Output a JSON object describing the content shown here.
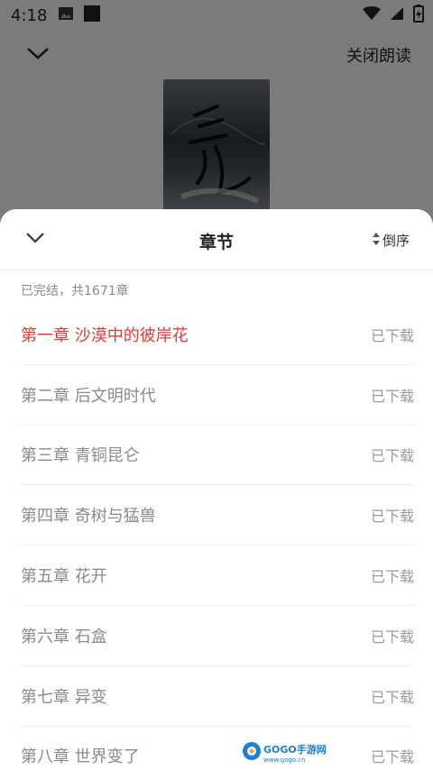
{
  "status_bar": {
    "time": "4:18"
  },
  "top_bar": {
    "close_read_label": "关闭朗读"
  },
  "sheet": {
    "title": "章节",
    "sort_label": "倒序",
    "summary": "已完结，共1671章",
    "chapters": [
      {
        "title": "第一章 沙漠中的彼岸花",
        "status": "已下载"
      },
      {
        "title": "第二章 后文明时代",
        "status": "已下载"
      },
      {
        "title": "第三章 青铜昆仑",
        "status": "已下载"
      },
      {
        "title": "第四章 奇树与猛兽",
        "status": "已下载"
      },
      {
        "title": "第五章 花开",
        "status": "已下载"
      },
      {
        "title": "第六章 石盒",
        "status": "已下载"
      },
      {
        "title": "第七章 异变",
        "status": "已下载"
      },
      {
        "title": "第八章 世界变了",
        "status": "已下载"
      }
    ]
  },
  "watermark": {
    "brand": "GOGO手游网",
    "url": "www.gogo.cn"
  },
  "colors": {
    "active_chapter": "#e53935",
    "inactive_text": "#8a8a8a",
    "overlay": "rgba(0,0,0,0.5)"
  }
}
